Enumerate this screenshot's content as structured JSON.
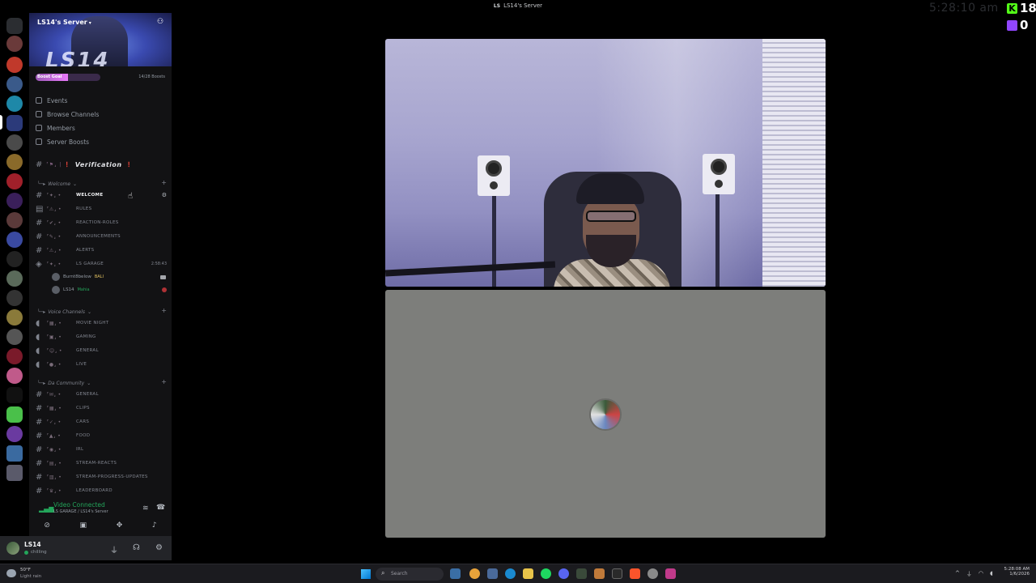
{
  "window": {
    "title": "LS14's Server",
    "server_abbrev": "LS"
  },
  "overlay": {
    "ghost_clock": "5:28:10 am",
    "kick_count": "18",
    "twitch_count": "0",
    "kick_letter": "K"
  },
  "server": {
    "name": "LS14's Server",
    "banner_text": "LS14",
    "boost_label": "Boost Goal",
    "boost_count": "14/28 Boosts",
    "boost_progress": 0.5
  },
  "menu": [
    {
      "label": "Events",
      "icon": "calendar-icon"
    },
    {
      "label": "Browse Channels",
      "icon": "browse-icon"
    },
    {
      "label": "Members",
      "icon": "members-icon"
    },
    {
      "label": "Server Boosts",
      "icon": "boost-icon"
    }
  ],
  "verification": {
    "label": "Verification"
  },
  "categories": {
    "welcome": "Welcome",
    "voice": "Voice Channels",
    "community": "Da Community"
  },
  "welcome_channels": [
    {
      "label": "WELCOME",
      "type": "text",
      "active": true
    },
    {
      "label": "RULES",
      "type": "rules"
    },
    {
      "label": "REACTION-ROLES",
      "type": "text"
    },
    {
      "label": "ANNOUNCEMENTS",
      "type": "text"
    },
    {
      "label": "ALERTS",
      "type": "text"
    },
    {
      "label": "LS GARAGE",
      "type": "voice-live",
      "time": "2:58:43"
    }
  ],
  "voice_users": [
    {
      "name": "Burnt8below",
      "tag": "BALI"
    },
    {
      "name": "LS14",
      "tag": "Mahia"
    }
  ],
  "voice_channels": [
    {
      "label": "MOVIE NIGHT"
    },
    {
      "label": "GAMING"
    },
    {
      "label": "GENERAL"
    },
    {
      "label": "LIVE"
    }
  ],
  "community_channels": [
    {
      "label": "GENERAL"
    },
    {
      "label": "CLIPS"
    },
    {
      "label": "CARS"
    },
    {
      "label": "FOOD"
    },
    {
      "label": "IRL"
    },
    {
      "label": "STREAM-REACTS"
    },
    {
      "label": "STREAM-PROGRESS-UPDATES"
    },
    {
      "label": "LEADERBOARD"
    }
  ],
  "rtc": {
    "status": "Video Connected",
    "location": "LS GARAGE / LS14's Server"
  },
  "user": {
    "name": "LS14",
    "status": "chilling"
  },
  "taskbar": {
    "temp": "50°F",
    "condition": "Light rain",
    "search": "Search",
    "time": "5:28:08 AM",
    "date": "1/6/2026"
  },
  "colors": {
    "accent_green": "#23a55a",
    "kick_green": "#53fc18",
    "twitch_purple": "#9146ff"
  }
}
